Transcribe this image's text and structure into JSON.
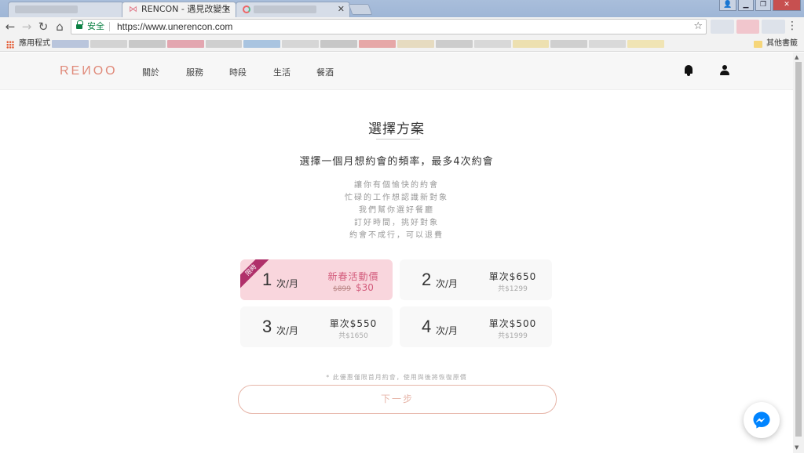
{
  "browser": {
    "tabs": [
      {
        "title": "",
        "blurred": true
      },
      {
        "title": "RENCON - 遇見改變生活",
        "active": true
      },
      {
        "title": "",
        "blurred": true
      }
    ],
    "security_label": "安全",
    "url": "https://www.unerencon.com",
    "bookmarks_apps_label": "應用程式",
    "other_bookmarks_label": "其他書籤"
  },
  "site": {
    "logo": "REИOO",
    "nav": [
      "關於",
      "服務",
      "時段",
      "生活",
      "餐酒"
    ]
  },
  "main": {
    "title": "選擇方案",
    "subtitle": "選擇一個月想約會的頻率，最多4次約會",
    "description": [
      "讓你有個愉快的約會",
      "忙碌的工作想認識新對象",
      "我們幫你選好餐廳",
      "訂好時間，挑好對象",
      "約會不成行，可以退費"
    ],
    "plans": [
      {
        "count": "1",
        "unit": "次/月",
        "price": "新春活動價",
        "old_price": "$899",
        "new_price": "$30",
        "badge": "限時",
        "selected": true
      },
      {
        "count": "2",
        "unit": "次/月",
        "price": "單次$650",
        "total": "共$1299",
        "selected": false
      },
      {
        "count": "3",
        "unit": "次/月",
        "price": "單次$550",
        "total": "共$1650",
        "selected": false
      },
      {
        "count": "4",
        "unit": "次/月",
        "price": "單次$500",
        "total": "共$1999",
        "selected": false
      }
    ],
    "note": "* 此優惠僅限首月約會，使用與後將恢復原價",
    "next_label": "下一步"
  },
  "colors": {
    "accent": "#e08a7a",
    "selected_plan_bg": "#f9d6dd",
    "badge": "#b0306a",
    "messenger": "#0084ff"
  }
}
